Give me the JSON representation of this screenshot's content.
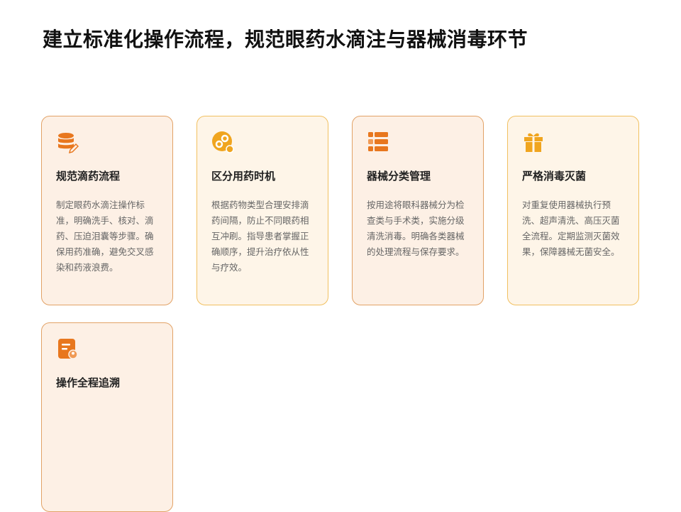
{
  "title": "建立标准化操作流程，规范眼药水滴注与器械消毒环节",
  "colors": {
    "accent_orange": "#e8771e",
    "accent_gold": "#f0a51f",
    "card_border": "#e2a266",
    "card_bg": "#fdf0e5"
  },
  "cards": [
    {
      "icon": "database-edit-icon",
      "title": "规范滴药流程",
      "desc": "制定眼药水滴注操作标准，明确洗手、核对、滴药、压迫泪囊等步骤。确保用药准确，避免交叉感染和药液浪费。"
    },
    {
      "icon": "link-circle-icon",
      "title": "区分用药时机",
      "desc": "根据药物类型合理安排滴药间隔，防止不同眼药相互冲刷。指导患者掌握正确顺序，提升治疗依从性与疗效。"
    },
    {
      "icon": "list-blocks-icon",
      "title": "器械分类管理",
      "desc": "按用途将眼科器械分为检查类与手术类，实施分级清洗消毒。明确各类器械的处理流程与保存要求。"
    },
    {
      "icon": "gift-box-icon",
      "title": "严格消毒灭菌",
      "desc": "对重复使用器械执行预洗、超声清洗、高压灭菌全流程。定期监测灭菌效果，保障器械无菌安全。"
    },
    {
      "icon": "document-user-icon",
      "title": "操作全程追溯",
      "desc": ""
    }
  ]
}
